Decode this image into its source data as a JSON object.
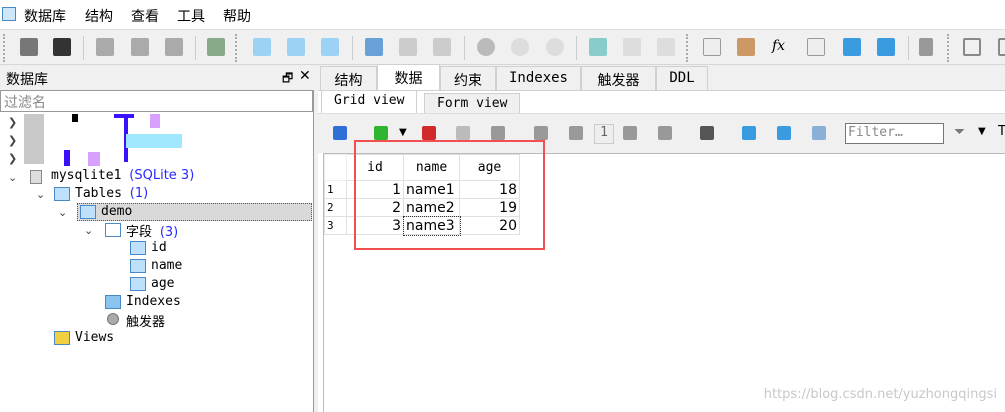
{
  "menu": [
    "数据库",
    "结构",
    "查看",
    "工具",
    "帮助"
  ],
  "left_panel": {
    "title": "数据库",
    "filter_placeholder": "过滤名",
    "tree": {
      "db": "mysqlite1",
      "db_type": "(SQLite 3)",
      "tables": "Tables",
      "tables_count": "(1)",
      "table": "demo",
      "fields": "字段",
      "fields_count": "(3)",
      "columns": [
        "id",
        "name",
        "age"
      ],
      "indexes": "Indexes",
      "triggers": "触发器",
      "views": "Views"
    }
  },
  "tabs": [
    "结构",
    "数据",
    "约束",
    "Indexes",
    "触发器",
    "DDL"
  ],
  "subtabs": [
    "Grid view",
    "Form view"
  ],
  "grid_toolbar": {
    "page": "1",
    "filter_placeholder": "Filter…",
    "trailing": "T"
  },
  "grid": {
    "columns": [
      "id",
      "name",
      "age"
    ],
    "rows": [
      [
        "1",
        "1",
        "name1",
        "18"
      ],
      [
        "2",
        "2",
        "name2",
        "19"
      ],
      [
        "3",
        "3",
        "name3",
        "20"
      ]
    ]
  },
  "watermark": "https://blog.csdn.net/yuzhongqingsi"
}
